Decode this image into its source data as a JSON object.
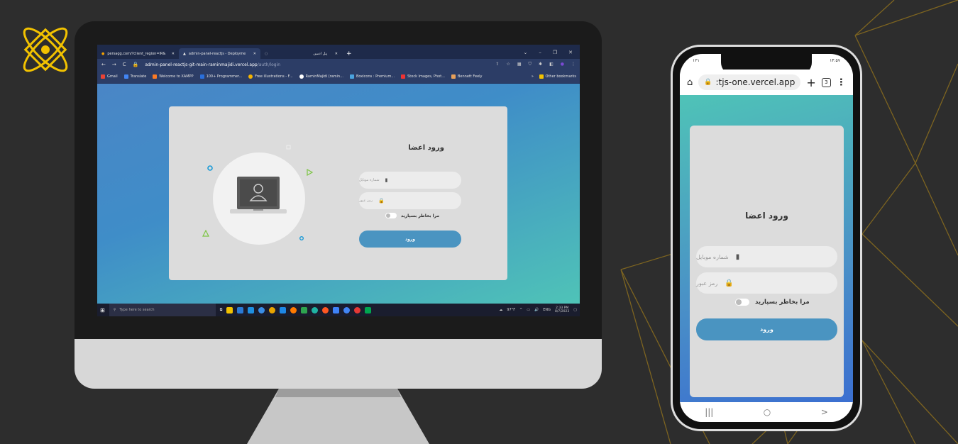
{
  "browser": {
    "tabs": [
      {
        "title": "persagg.com/?client_region=IR&",
        "active": false
      },
      {
        "title": "admin-panel-reactjs - Deployme",
        "active": true
      },
      {
        "title": "پنل ادمین",
        "active": false
      }
    ],
    "url_main": "admin-panel-reactjs-git-main-raminmajidi.vercel.app",
    "url_path": "/auth/login",
    "bookmarks": [
      "Gmail",
      "Translate",
      "Welcome to XAMPP",
      "100+ Programmer...",
      "Free illustrations - F...",
      "RaminMajidi (ramin...",
      "Boxicons : Premium...",
      "Stock Images, Phot...",
      "Bennett Feely"
    ],
    "other_bookmarks": "Other bookmarks"
  },
  "login": {
    "title": "ورود اعضا",
    "mobile_placeholder": "شماره موبایل",
    "password_placeholder": "رمز عبور",
    "remember_label": "مرا بخاطر بسپارید",
    "submit_label": "ورود"
  },
  "taskbar": {
    "search_placeholder": "Type here to search",
    "weather": "97°F",
    "lang": "ENG",
    "time": "2:33 PM",
    "date": "8/7/2023"
  },
  "phone": {
    "status_left": "۱۴:۵۷",
    "status_right": "۱۳۱",
    "url": ":tjs-one.vercel.app",
    "tab_count": "3"
  },
  "colors": {
    "accent": "#4a94c1",
    "logo": "#f2c200",
    "background": "#2d2d2d"
  }
}
